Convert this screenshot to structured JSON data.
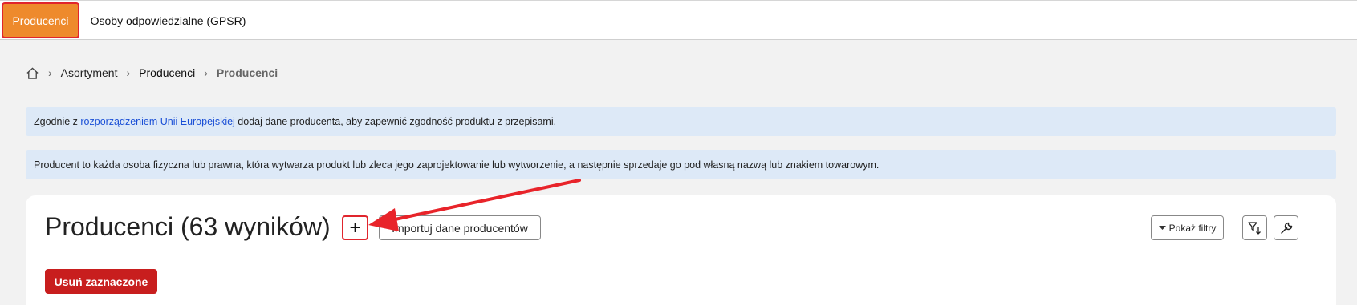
{
  "tabs": [
    {
      "label": "Producenci",
      "active": true
    },
    {
      "label": "Osoby odpowiedzialne (GPSR)",
      "active": false
    }
  ],
  "breadcrumb": {
    "home_icon": "home-icon",
    "items": [
      "Asortyment",
      "Producenci",
      "Producenci"
    ]
  },
  "info": {
    "line1_prefix": "Zgodnie z ",
    "line1_link": "rozporządzeniem Unii Europejskiej",
    "line1_suffix": " dodaj dane producenta, aby zapewnić zgodność produktu z przepisami.",
    "line2": "Producent to każda osoba fizyczna lub prawna, która wytwarza produkt lub zleca jego zaprojektowanie lub wytworzenie, a następnie sprzedaje go pod własną nazwą lub znakiem towarowym."
  },
  "main": {
    "title": "Producenci (63 wyników)",
    "add_label": "+",
    "import_label": "Importuj dane producentów",
    "filters_label": "Pokaż filtry",
    "delete_label": "Usuń zaznaczone"
  },
  "colors": {
    "active_tab": "#ee8a2c",
    "highlight": "#e0252d",
    "delete_button": "#c81e1e",
    "info_bg": "#dde9f7",
    "link": "#1a4fd6"
  }
}
